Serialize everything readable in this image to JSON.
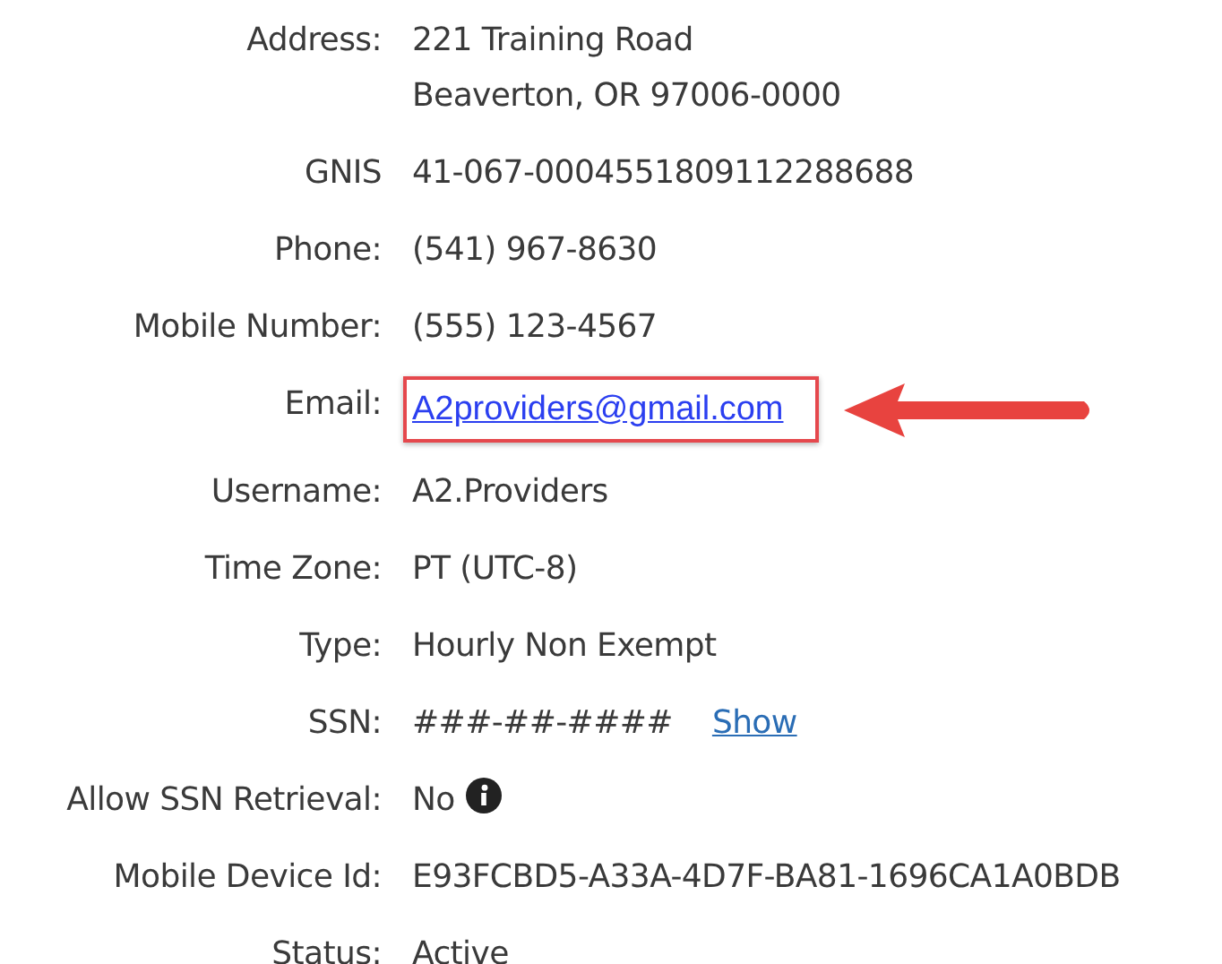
{
  "fields": [
    {
      "kind": "text",
      "label": "Address:",
      "lines": [
        "221 Training Road",
        "Beaverton, OR 97006-0000"
      ]
    },
    {
      "kind": "text",
      "label": "GNIS",
      "lines": [
        "41-067-0004551809112288688"
      ]
    },
    {
      "kind": "text",
      "label": "Phone:",
      "lines": [
        "(541) 967-8630"
      ]
    },
    {
      "kind": "text",
      "label": "Mobile Number:",
      "lines": [
        "(555) 123-4567"
      ]
    },
    {
      "kind": "email",
      "label": "Email:",
      "link": "A2providers@gmail.com",
      "highlighted": true
    },
    {
      "kind": "text",
      "label": "Username:",
      "lines": [
        "A2.Providers"
      ]
    },
    {
      "kind": "text",
      "label": "Time Zone:",
      "lines": [
        "PT (UTC-8)"
      ]
    },
    {
      "kind": "text",
      "label": "Type:",
      "lines": [
        "Hourly Non Exempt"
      ]
    },
    {
      "kind": "action",
      "label": "SSN:",
      "value": "###-##-####",
      "action": "Show"
    },
    {
      "kind": "info",
      "label": "Allow SSN Retrieval:",
      "value": "No"
    },
    {
      "kind": "text",
      "label": "Mobile Device Id:",
      "lines": [
        "E93FCBD5-A33A-4D7F-BA81-1696CA1A0BDB"
      ]
    },
    {
      "kind": "text",
      "label": "Status:",
      "lines": [
        "Active"
      ]
    }
  ]
}
